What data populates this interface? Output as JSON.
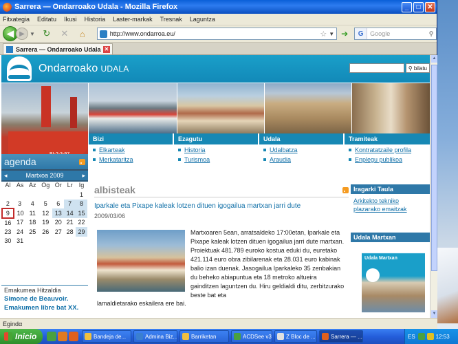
{
  "window": {
    "title": "Sarrera — Ondarroako Udala - Mozilla Firefox",
    "controls": {
      "minimize": "_",
      "maximize": "□",
      "close": "✕"
    }
  },
  "menubar": [
    "Fitxategia",
    "Editatu",
    "Ikusi",
    "Historia",
    "Laster-markak",
    "Tresnak",
    "Laguntza"
  ],
  "navbar": {
    "url": "http://www.ondarroa.eu/",
    "search_placeholder": "Google",
    "search_engine_glyph": "G"
  },
  "tab": {
    "label": "Sarrera — Ondarroako Udala"
  },
  "site": {
    "title": "Ondarroako",
    "title_small": "UDALA",
    "search_button": "bilatu",
    "sections": [
      {
        "head": "Bizi",
        "links": [
          "Elkarteak",
          "Merkataritza"
        ]
      },
      {
        "head": "Ezagutu",
        "links": [
          "Historia",
          "Turismoa"
        ]
      },
      {
        "head": "Udala",
        "links": [
          "Udalbatza",
          "Araudia"
        ]
      },
      {
        "head": "Tramiteak",
        "links": [
          "Kontratatzaile profila",
          "Enplegu publikoa"
        ]
      }
    ],
    "boat_text": "BI-2-3-97"
  },
  "agenda": {
    "title": "agenda",
    "month": "Martxoa 2009",
    "prev": "◂",
    "next": "▸",
    "weekdays": [
      "Al",
      "As",
      "Az",
      "Og",
      "Or",
      "Lr",
      "Ig"
    ],
    "weeks": [
      [
        "",
        "",
        "",
        "",
        "",
        "",
        "1"
      ],
      [
        "2",
        "3",
        "4",
        "5",
        "6",
        "7",
        "8"
      ],
      [
        "9",
        "10",
        "11",
        "12",
        "13",
        "14",
        "15"
      ],
      [
        "16",
        "17",
        "18",
        "19",
        "20",
        "21",
        "22"
      ],
      [
        "23",
        "24",
        "25",
        "26",
        "27",
        "28",
        "29"
      ],
      [
        "30",
        "31",
        "",
        "",
        "",
        "",
        ""
      ]
    ],
    "event_days": [
      "7",
      "8",
      "13",
      "14",
      "15",
      "29"
    ],
    "today": "9",
    "feature_label": "Emakumea Hitzaldia",
    "feature_text_1": "Simone de Beauvoir.",
    "feature_text_2": "Emakumen libre bat XX."
  },
  "news": {
    "section_title": "albisteak",
    "title": "Iparkale eta Pixape kaleak lotzen dituen igogailua martxan jarri dute",
    "date": "2009/03/06",
    "body": "Martxoaren 5ean, arratsaldeko 17:00etan, Iparkale eta Pixape kaleak lotzen dituen igogailua jarri dute martxan. Proiektuak 481.789 euroko kostua eduki du, euretako 421.114 euro obra zibilarenak eta 28.031 euro kabinak balio izan duenak. Jasogailua Iparkaleko 35 zenbakian du beheko abiapuntua eta 18 metroko altueira gainditzen laguntzen du. Hiru geldialdi ditu, zerbitzurako beste bat eta",
    "body_end": "lamaldietarako eskailera ere bai."
  },
  "right": {
    "head1": "Iragarki Taula",
    "link1": "Arkitekto tekniko plazarako emaitzak",
    "head2": "Udala Martxan",
    "poster_title": "Udala Martxan"
  },
  "statusbar": {
    "text": "Egindα"
  },
  "taskbar": {
    "start": "Inicio",
    "tasks": [
      {
        "label": "Bandeja de...",
        "color": "#f0c040"
      },
      {
        "label": "Admina Biz...",
        "color": "#3a7fd0"
      },
      {
        "label": "Barriketan",
        "color": "#f0c040"
      },
      {
        "label": "ACDSee v3...",
        "color": "#4aa040"
      },
      {
        "label": "Z Bloc de ...",
        "color": "#e0e0e0"
      },
      {
        "label": "Sarrera — ...",
        "color": "#e0601e"
      }
    ],
    "lang": "ES",
    "clock": "12:53"
  },
  "colors": {
    "site_blue": "#1788b4",
    "link_blue": "#1170a8",
    "titlebar": "#0a5fd8",
    "rss_orange": "#f59b21"
  }
}
